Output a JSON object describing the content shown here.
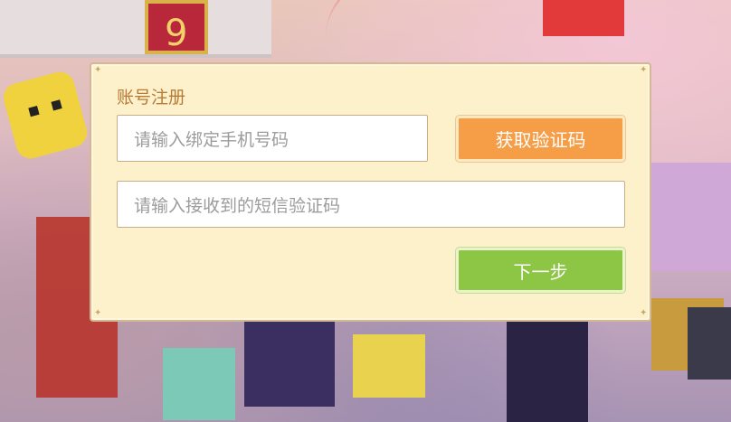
{
  "background": {
    "sign_number": "9"
  },
  "dialog": {
    "title": "账号注册",
    "phone_input": {
      "placeholder": "请输入绑定手机号码",
      "value": ""
    },
    "get_code_button": "获取验证码",
    "sms_input": {
      "placeholder": "请输入接收到的短信验证码",
      "value": ""
    },
    "next_button": "下一步"
  },
  "colors": {
    "panel_bg": "#fdf1cb",
    "title": "#b77b36",
    "get_code_button": "#f59d47",
    "next_button": "#8dc545",
    "placeholder": "#9c9c9c"
  }
}
